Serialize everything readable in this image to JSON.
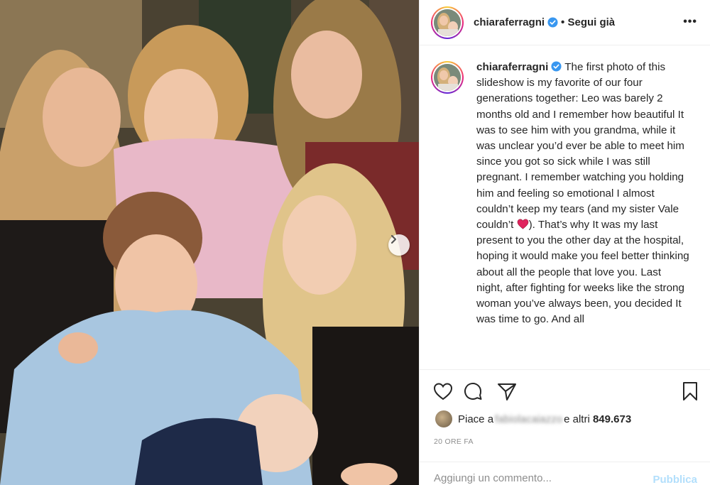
{
  "post": {
    "username": "chiaraferragni",
    "follow_label": "• Segui già",
    "more_icon": "three-dots-icon",
    "caption_text": "The first photo of this slideshow is my favorite of our four generations together: Leo was barely 2 months old and I remember how beautiful It was to see him with you grandma, while it was unclear you’d ever be able to meet him since you got so sick while I was still pregnant. I remember watching you holding him and feeling so emotional I almost couldn’t keep my tears (and my sister Vale couldn’t",
    "caption_text_after_emoji": "). That’s why It was my last present to you the other day at the hospital, hoping it would make you feel better thinking about all the people that love you. Last night, after fighting for weeks like the strong woman you’ve always been, you decided It was time to go. And all",
    "caption_emoji": "red-heart-icon"
  },
  "actions": {
    "like_icon": "heart-icon",
    "comment_icon": "comment-icon",
    "share_icon": "paper-plane-icon",
    "save_icon": "bookmark-icon"
  },
  "likes": {
    "prefix": "Piace a",
    "blurred_user": "fabiolacaiazzo",
    "suffix": "e altri",
    "count": "849.673"
  },
  "timestamp": "20 ORE FA",
  "comment": {
    "placeholder": "Aggiungi un commento...",
    "publish_label": "Pubblica"
  },
  "colors": {
    "text": "#262626",
    "muted": "#8e8e8e",
    "verified": "#3897f0",
    "publish_disabled": "#b2dffc",
    "heart_emoji": "#e0245e"
  }
}
